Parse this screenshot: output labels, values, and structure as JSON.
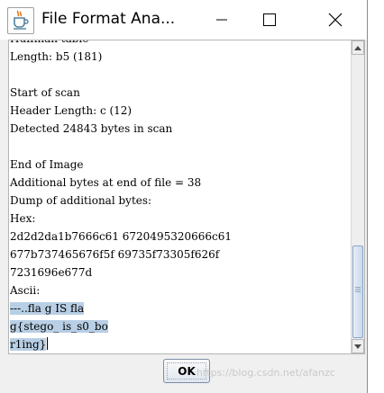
{
  "window": {
    "title": "File Format Ana...",
    "icon": "java-cup-icon"
  },
  "titlebar_buttons": {
    "minimize_icon": "minimize-icon",
    "maximize_icon": "maximize-icon",
    "close_icon": "close-icon"
  },
  "content": {
    "lines": [
      "Huffman table",
      "Length: b5 (181)",
      "",
      "Start of scan",
      "Header Length: c (12)",
      "Detected 24843 bytes in scan",
      "",
      "End of Image",
      "Additional bytes at end of file = 38",
      "Dump of additional bytes:",
      "Hex:",
      "2d2d2da1b7666c61 6720495320666c61",
      "677b737465676f5f 69735f73305f626f",
      "7231696e677d",
      "Ascii:",
      "---..fla g IS fla",
      "g{stego_ is_s0_bo",
      "r1ing}"
    ],
    "highlighted_from_line": 15
  },
  "buttons": {
    "ok_label": "OK"
  },
  "watermark": "https://blog.csdn.net/afanzc",
  "colors": {
    "selection": "#b8cfe5",
    "scroll_thumb": "#c9d8e9"
  }
}
